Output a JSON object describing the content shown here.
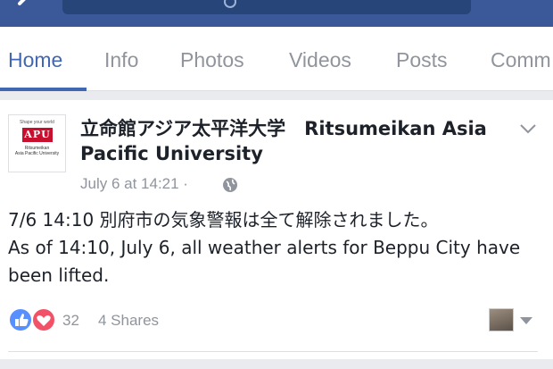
{
  "colors": {
    "brand": "#3b5998",
    "tab_active": "#4267b2",
    "like_blue": "#5890ff",
    "love_red": "#f25268"
  },
  "header": {
    "back_icon": "back-arrow-icon",
    "search_icon": "search-icon"
  },
  "tabs": [
    {
      "label": "Home",
      "active": true
    },
    {
      "label": "Info",
      "active": false
    },
    {
      "label": "Photos",
      "active": false
    },
    {
      "label": "Videos",
      "active": false
    },
    {
      "label": "Posts",
      "active": false
    },
    {
      "label": "Comm",
      "active": false
    }
  ],
  "post": {
    "avatar": {
      "tagline": "Shape your world",
      "logo": "APU",
      "sub1": "Ritsumeikan",
      "sub2": "Asia Pacific University"
    },
    "page_name": "立命館アジア太平洋大学　Ritsumeikan Asia Pacific University",
    "timestamp": "July 6 at 14:21 ·",
    "privacy_icon": "globe-icon",
    "text_line1": "7/6 14:10 別府市の気象警報は全て解除されました。",
    "text_line2": "As of 14:10, July 6, all weather alerts for Beppu City have been lifted.",
    "reactions": [
      "like-icon",
      "love-icon"
    ],
    "reaction_count": "32",
    "shares": "4 Shares"
  }
}
